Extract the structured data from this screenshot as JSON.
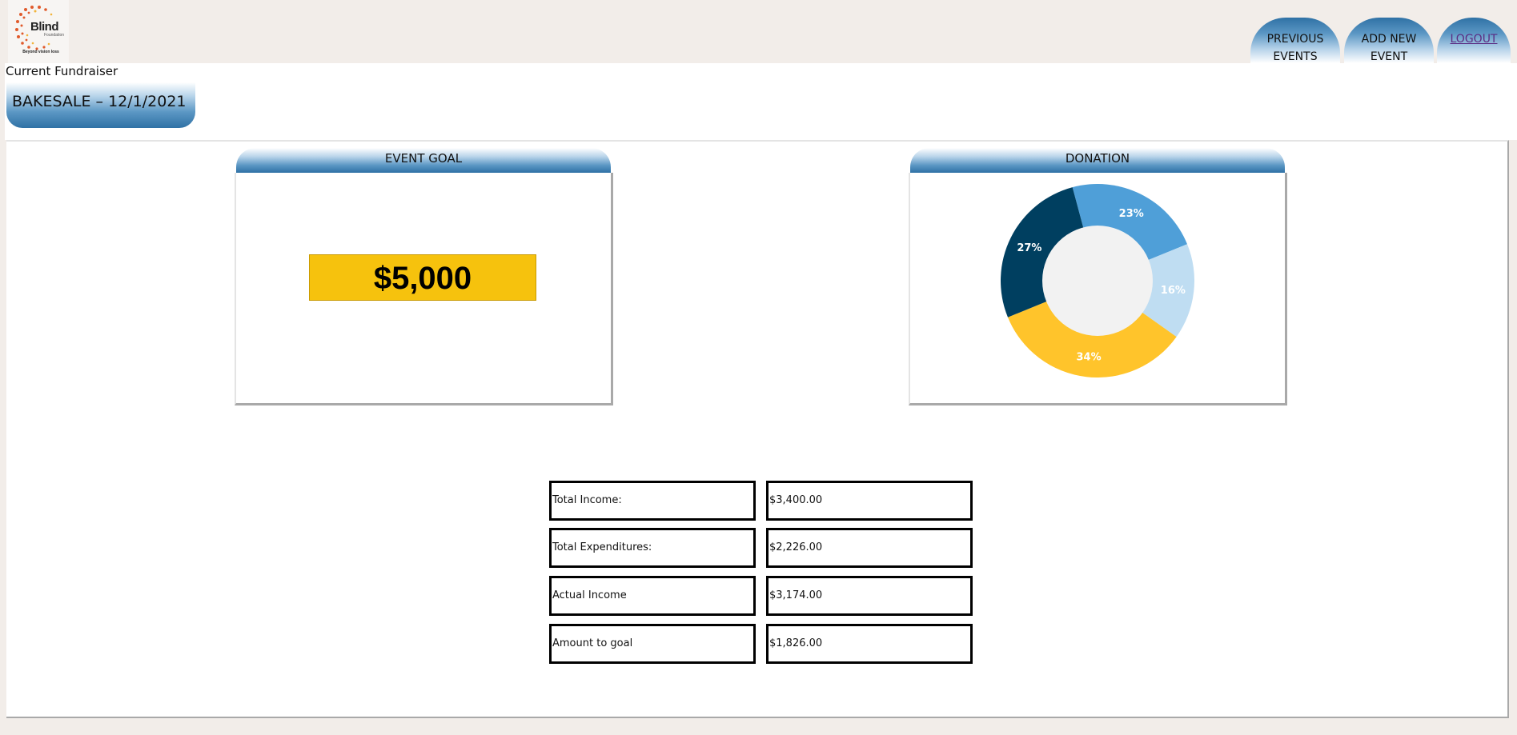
{
  "logo": {
    "text": "Blind",
    "tiny": "Foundation",
    "tagline": "Beyond vision loss"
  },
  "nav": {
    "previous_events": "PREVIOUS EVENTS",
    "add_new_event": "ADD NEW EVENT",
    "logout": "LOGOUT"
  },
  "header": {
    "current_label": "Current Fundraiser",
    "event_name": "BAKESALE – 12/1/2021"
  },
  "goal_card": {
    "title": "EVENT GOAL",
    "amount": "$5,000"
  },
  "donation_card": {
    "title": "DONATION"
  },
  "chart_data": {
    "type": "pie",
    "variant": "donut",
    "slices": [
      {
        "label": "23%",
        "value": 23,
        "color": "#4f9fd8"
      },
      {
        "label": "16%",
        "value": 16,
        "color": "#bfddf2"
      },
      {
        "label": "34%",
        "value": 34,
        "color": "#ffc42b"
      },
      {
        "label": "27%",
        "value": 27,
        "color": "#003f60"
      }
    ],
    "center_color": "#f2f2f2"
  },
  "financials": [
    {
      "label": "Total Income:",
      "value": "$3,400.00"
    },
    {
      "label": "Total Expenditures:",
      "value": "$2,226.00"
    },
    {
      "label": "Actual Income",
      "value": "$3,174.00"
    },
    {
      "label": "Amount to goal",
      "value": "$1,826.00"
    }
  ]
}
